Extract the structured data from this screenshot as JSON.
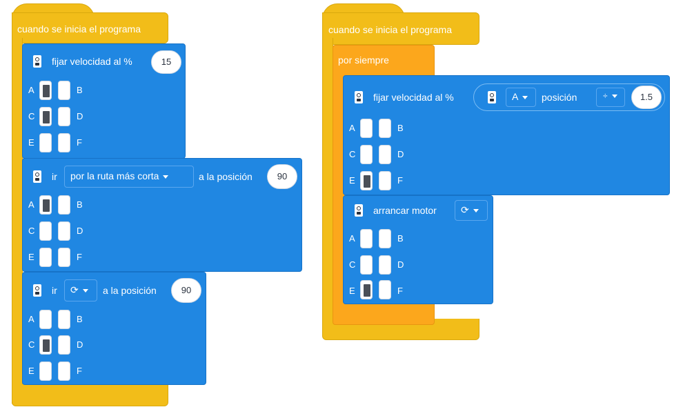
{
  "stack1": {
    "hat_label": "cuando se inicia el programa",
    "speed_block": {
      "label": "fijar velocidad al %",
      "value": "15"
    },
    "go_shortest": {
      "prefix": "ir",
      "route": "por la ruta más corta",
      "suffix": "a la posición",
      "value": "90"
    },
    "go_cw": {
      "prefix": "ir",
      "direction_icon": "clockwise-icon",
      "suffix": "a la posición",
      "value": "90"
    }
  },
  "stack2": {
    "hat_label": "cuando se inicia el programa",
    "loop_label": "por siempre",
    "speed_block": {
      "label": "fijar velocidad al %",
      "sensor_port": "A",
      "sensor_label": "posición",
      "operator": "÷",
      "value": "1.5"
    },
    "start_motor": {
      "label": "arrancar motor",
      "direction_icon": "clockwise-icon"
    }
  },
  "ports": {
    "a": "A",
    "b": "B",
    "c": "C",
    "d": "D",
    "e": "E",
    "f": "F"
  },
  "colors": {
    "event_yellow": "#f2bd19",
    "loop_orange": "#fca71c",
    "motor_blue": "#2087e2",
    "port_selected": "#4a4f57"
  }
}
